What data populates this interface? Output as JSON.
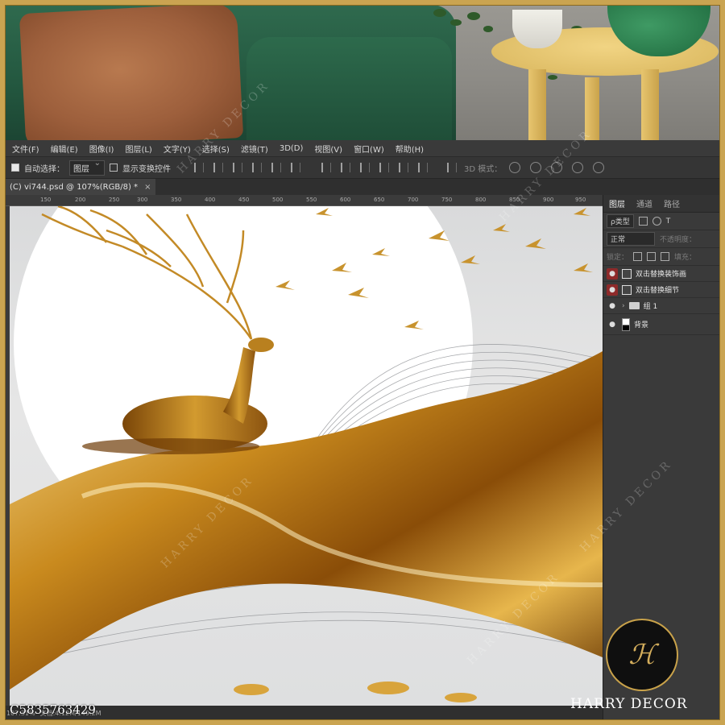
{
  "menu": [
    "文件(F)",
    "编辑(E)",
    "图像(I)",
    "图层(L)",
    "文字(Y)",
    "选择(S)",
    "滤镜(T)",
    "3D(D)",
    "视图(V)",
    "窗口(W)",
    "帮助(H)"
  ],
  "options": {
    "auto_select_label": "自动选择：",
    "auto_select_value": "图层",
    "show_transform_label": "显示变换控件",
    "mode_3d_label": "3D 模式："
  },
  "document_tab": {
    "title": "(C) vi744.psd @ 107%(RGB/8) *",
    "close_icon": "close-icon"
  },
  "ruler_ticks": [
    "150",
    "200",
    "250",
    "300",
    "350",
    "400",
    "450",
    "500",
    "550",
    "600",
    "650",
    "700",
    "750",
    "800",
    "850",
    "900",
    "950"
  ],
  "status": {
    "zoom": "107.31%",
    "doc_info": "文档:4.12M/149.2M"
  },
  "panel": {
    "tabs": [
      "图层",
      "通道",
      "路径"
    ],
    "filter_label": "ρ类型",
    "blend_mode": "正常",
    "opacity_label": "不透明度：",
    "lock_label": "锁定：",
    "fill_label": "填充："
  },
  "layers": [
    {
      "name": "双击替换装饰画",
      "type": "smart-object",
      "highlight": true
    },
    {
      "name": "双击替换细节",
      "type": "smart-object",
      "highlight": true
    },
    {
      "name": "组 1",
      "type": "group",
      "highlight": false
    },
    {
      "name": "背景",
      "type": "background",
      "highlight": false
    }
  ],
  "watermark": {
    "text": "HARRY DECOR",
    "code": "C5835763429",
    "logo_glyph": "ℋ"
  },
  "colors": {
    "frame_gold": "#caa451",
    "sofa_green": "#23573f",
    "ps_dark": "#2b2b2b",
    "layer_highlight": "#8e2a2a"
  }
}
